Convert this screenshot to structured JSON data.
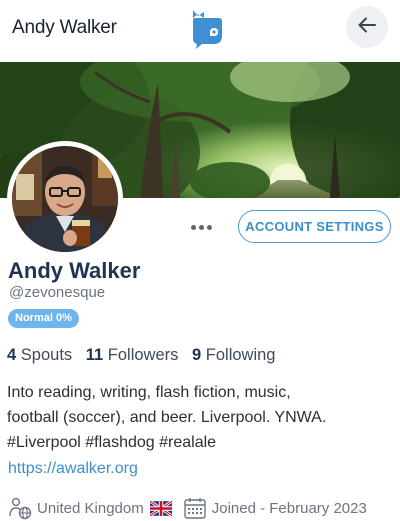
{
  "header": {
    "title": "Andy Walker",
    "logo_icon": "whale-logo-icon",
    "back_icon": "arrow-left-icon"
  },
  "profile": {
    "name": "Andy Walker",
    "handle": "@zevonesque",
    "badge": "Normal 0%",
    "account_settings_label": "ACCOUNT SETTINGS",
    "more_icon": "more-dots-icon"
  },
  "stats": [
    {
      "count": "4",
      "label": "Spouts"
    },
    {
      "count": "11",
      "label": "Followers"
    },
    {
      "count": "9",
      "label": "Following"
    }
  ],
  "bio": {
    "line1": "Into reading, writing, flash fiction, music,",
    "line2": "football (soccer), and beer. Liverpool. YNWA.",
    "line3": "#Liverpool #flashdog #realale"
  },
  "website": "https://awalker.org",
  "meta": {
    "location": "United Kingdom",
    "location_icon": "globe-person-icon",
    "flag_icon": "uk-flag-icon",
    "joined": "Joined - February 2023",
    "calendar_icon": "calendar-icon"
  },
  "colors": {
    "accent": "#3d8fcb",
    "badge": "#6db5ec",
    "name": "#1d3453",
    "logo": "#3f8fd2"
  }
}
